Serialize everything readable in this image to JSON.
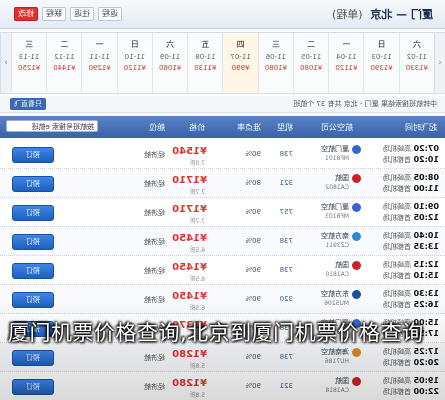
{
  "header": {
    "route": "厦门 — 北京",
    "route_note": "(单程)",
    "tools": [
      "返程",
      "往返",
      "联程"
    ],
    "action_label": "修改"
  },
  "calendar": {
    "prev_arrow": "‹",
    "next_arrow": "›",
    "days": [
      {
        "week": "六",
        "date": "11-02",
        "price": "¥1330"
      },
      {
        "week": "日",
        "date": "11-03",
        "price": "¥1390"
      },
      {
        "week": "一",
        "date": "11-04",
        "price": "¥1120"
      },
      {
        "week": "二",
        "date": "11-05",
        "price": "¥1080"
      },
      {
        "week": "三",
        "date": "11-06",
        "price": "¥1080"
      },
      {
        "week": "四",
        "date": "11-07",
        "price": "¥990"
      },
      {
        "week": "五",
        "date": "11-08",
        "price": "¥1130"
      },
      {
        "week": "六",
        "date": "11-09",
        "price": "¥1060"
      },
      {
        "week": "日",
        "date": "11-10",
        "price": "¥1120"
      },
      {
        "week": "一",
        "date": "11-11",
        "price": "¥1290"
      },
      {
        "week": "二",
        "date": "11-12",
        "price": "¥1440"
      },
      {
        "week": "三",
        "date": "11-13",
        "price": "¥1250"
      }
    ]
  },
  "sortbar": {
    "text": "中转航班搜索结果 厦门 - 北京 共有 37 个航班",
    "reco": "只看直飞"
  },
  "columns": {
    "time": "起飞时间",
    "airline": "航空公司",
    "plane": "机型",
    "ontime": "准点率",
    "price": "价格",
    "cls": "舱位",
    "filter": "按航班号搜索 e航班"
  },
  "flights": [
    {
      "t1": "07:20",
      "t2": "10:20",
      "a1": "高崎机场",
      "a2": "首都机场",
      "airline": "厦门航空",
      "fno": "MF8101",
      "plane": "738",
      "ontime": "90%",
      "price": "¥1540",
      "disc": "7.0折",
      "cls": "经济舱",
      "book": "预订",
      "color": "#3366cc"
    },
    {
      "t1": "08:05",
      "t2": "11:00",
      "a1": "高崎机场",
      "a2": "首都机场",
      "airline": "国航",
      "fno": "CA1802",
      "plane": "321",
      "ontime": "80%",
      "price": "¥1710",
      "disc": "7.7折",
      "cls": "经济舱",
      "book": "预订",
      "color": "#cc2222"
    },
    {
      "t1": "09:10",
      "t2": "12:05",
      "a1": "高崎机场",
      "a2": "首都机场",
      "airline": "厦门航空",
      "fno": "MF8103",
      "plane": "757",
      "ontime": "90%",
      "price": "¥1710",
      "disc": "7.7折",
      "cls": "经济舱",
      "book": "预订",
      "color": "#3366cc"
    },
    {
      "t1": "10:40",
      "t2": "13:35",
      "a1": "高崎机场",
      "a2": "首都机场",
      "airline": "南方航空",
      "fno": "CZ3911",
      "plane": "738",
      "ontime": "90%",
      "price": "¥1450",
      "disc": "6.5折",
      "cls": "经济舱",
      "book": "预订",
      "color": "#2a8bd0"
    },
    {
      "t1": "12:15",
      "t2": "15:10",
      "a1": "高崎机场",
      "a2": "首都机场",
      "airline": "国航",
      "fno": "CA1810",
      "plane": "738",
      "ontime": "90%",
      "price": "¥1450",
      "disc": "6.5折",
      "cls": "经济舱",
      "book": "预订",
      "color": "#cc2222"
    },
    {
      "t1": "13:30",
      "t2": "16:25",
      "a1": "高崎机场",
      "a2": "首都机场",
      "airline": "东方航空",
      "fno": "MU5206",
      "plane": "320",
      "ontime": "90%",
      "price": "¥1450",
      "disc": "6.5折",
      "cls": "经济舱",
      "book": "预订",
      "color": "#1b4f9c"
    },
    {
      "t1": "15:00",
      "t2": "17:55",
      "a1": "高崎机场",
      "a2": "首都机场",
      "airline": "厦门航空",
      "fno": "MF8105",
      "plane": "738",
      "ontime": "90%",
      "price": "¥1370",
      "disc": "6.2折",
      "cls": "经济舱",
      "book": "预订",
      "color": "#3366cc"
    },
    {
      "t1": "17:25",
      "t2": "20:20",
      "a1": "高崎机场",
      "a2": "首都机场",
      "airline": "海南航空",
      "fno": "HU7186",
      "plane": "738",
      "ontime": "90%",
      "price": "¥1280",
      "disc": "5.8折",
      "cls": "经济舱",
      "book": "预订",
      "color": "#d98a1f"
    },
    {
      "t1": "19:05",
      "t2": "22:00",
      "a1": "高崎机场",
      "a2": "首都机场",
      "airline": "国航",
      "fno": "CA1818",
      "plane": "321",
      "ontime": "90%",
      "price": "¥1280",
      "disc": "5.8折",
      "cls": "经济舱",
      "book": "预订",
      "color": "#cc2222"
    }
  ],
  "overlay_title": "厦门机票价格查询,北京到厦门机票价格查询"
}
